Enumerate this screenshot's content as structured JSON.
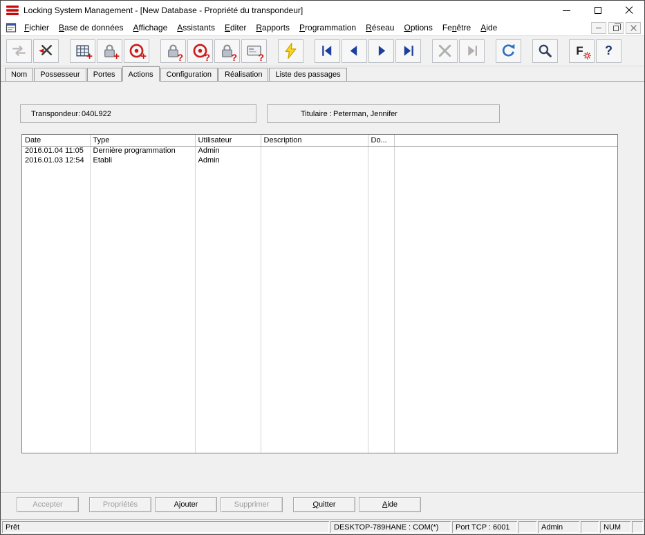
{
  "window": {
    "title": "Locking System Management - [New Database - Propriété du transpondeur]"
  },
  "menu": {
    "items": [
      {
        "pre": "",
        "key": "F",
        "rest": "ichier"
      },
      {
        "pre": "",
        "key": "B",
        "rest": "ase de données"
      },
      {
        "pre": "",
        "key": "A",
        "rest": "ffichage"
      },
      {
        "pre": "",
        "key": "A",
        "rest": "ssistants"
      },
      {
        "pre": "",
        "key": "E",
        "rest": "diter"
      },
      {
        "pre": "",
        "key": "R",
        "rest": "apports"
      },
      {
        "pre": "",
        "key": "P",
        "rest": "rogrammation"
      },
      {
        "pre": "",
        "key": "R",
        "rest": "éseau"
      },
      {
        "pre": "",
        "key": "O",
        "rest": "ptions"
      },
      {
        "pre": "Fe",
        "key": "n",
        "rest": "être"
      },
      {
        "pre": "",
        "key": "A",
        "rest": "ide"
      }
    ]
  },
  "toolbar": {
    "icons": [
      "transfer-arrows-disabled",
      "disconnect-x",
      "matrix-add",
      "lock-add",
      "transponder-add",
      "lock-query",
      "transponder-query",
      "lock-query-2",
      "card-query",
      "program-flash",
      "nav-first",
      "nav-prev",
      "nav-next",
      "nav-last",
      "nav-cancel-disabled",
      "nav-skip-disabled",
      "refresh",
      "search",
      "filter-gear",
      "help"
    ],
    "accent_red": "#cf1010",
    "nav_blue": "#1c3f9e",
    "bolt_yellow": "#ffd61a"
  },
  "tabs": {
    "items": [
      {
        "label": "Nom"
      },
      {
        "label": "Possesseur"
      },
      {
        "label": "Portes"
      },
      {
        "label": "Actions"
      },
      {
        "label": "Configuration"
      },
      {
        "label": "Réalisation"
      },
      {
        "label": "Liste des passages"
      }
    ],
    "active": "Actions"
  },
  "panel": {
    "transponder_label": "Transpondeur:",
    "transponder_value": "040L922",
    "holder_label": "Titulaire :",
    "holder_value": "Peterman, Jennifer"
  },
  "table": {
    "columns": [
      {
        "label": "Date"
      },
      {
        "label": "Type"
      },
      {
        "label": "Utilisateur"
      },
      {
        "label": "Description"
      },
      {
        "label": "Do..."
      },
      {
        "label": ""
      }
    ],
    "rows": [
      {
        "date": "2016.01.04 11:05",
        "type": "Dernière programmation",
        "user": "Admin",
        "description": "",
        "doc": ""
      },
      {
        "date": "2016.01.03 12:54",
        "type": "Etabli",
        "user": "Admin",
        "description": "",
        "doc": ""
      }
    ]
  },
  "buttons": {
    "items": [
      {
        "pre": "",
        "key": "",
        "rest": "Accepter",
        "disabled": true
      },
      {
        "pre": "",
        "key": "",
        "rest": "Propriétés",
        "disabled": true
      },
      {
        "pre": "",
        "key": "",
        "rest": "Ajouter",
        "disabled": false
      },
      {
        "pre": "",
        "key": "",
        "rest": "Supprimer",
        "disabled": true
      },
      {
        "pre": "",
        "key": "Q",
        "rest": "uitter",
        "disabled": false
      },
      {
        "pre": "",
        "key": "A",
        "rest": "ide",
        "disabled": false
      }
    ]
  },
  "statusbar": {
    "ready": "Prêt",
    "segments": [
      {
        "text": "DESKTOP-789HANE : COM(*)"
      },
      {
        "text": "Port TCP : 6001"
      },
      {
        "text": ""
      },
      {
        "text": "Admin"
      },
      {
        "text": ""
      },
      {
        "text": "NUM"
      },
      {
        "text": ""
      }
    ]
  }
}
